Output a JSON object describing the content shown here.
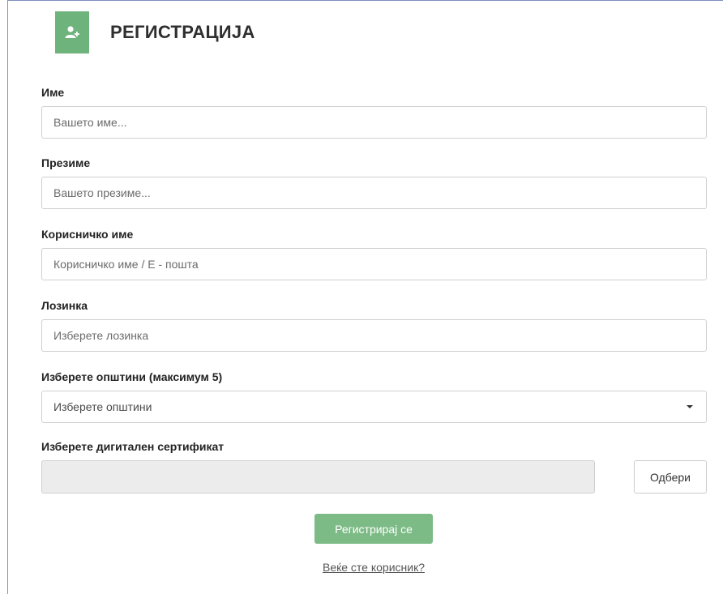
{
  "header": {
    "title": "РЕГИСТРАЦИЈА",
    "icon": "add-user-icon",
    "icon_bg": "#6fb37c"
  },
  "form": {
    "first_name": {
      "label": "Име",
      "placeholder": "Вашето име..."
    },
    "last_name": {
      "label": "Презиме",
      "placeholder": "Вашето презиме..."
    },
    "username": {
      "label": "Корисничко име",
      "placeholder": "Корисничко име / Е - пошта"
    },
    "password": {
      "label": "Лозинка",
      "placeholder": "Изберете лозинка"
    },
    "municipalities": {
      "label": "Изберете општини (максимум 5)",
      "selected": "Изберете општини"
    },
    "certificate": {
      "label": "Изберете дигитален сертификат",
      "browse_label": "Одбери"
    }
  },
  "actions": {
    "register_label": "Регистрирај се",
    "register_color": "#7dbb86",
    "login_link": "Веќе сте корисник?"
  }
}
